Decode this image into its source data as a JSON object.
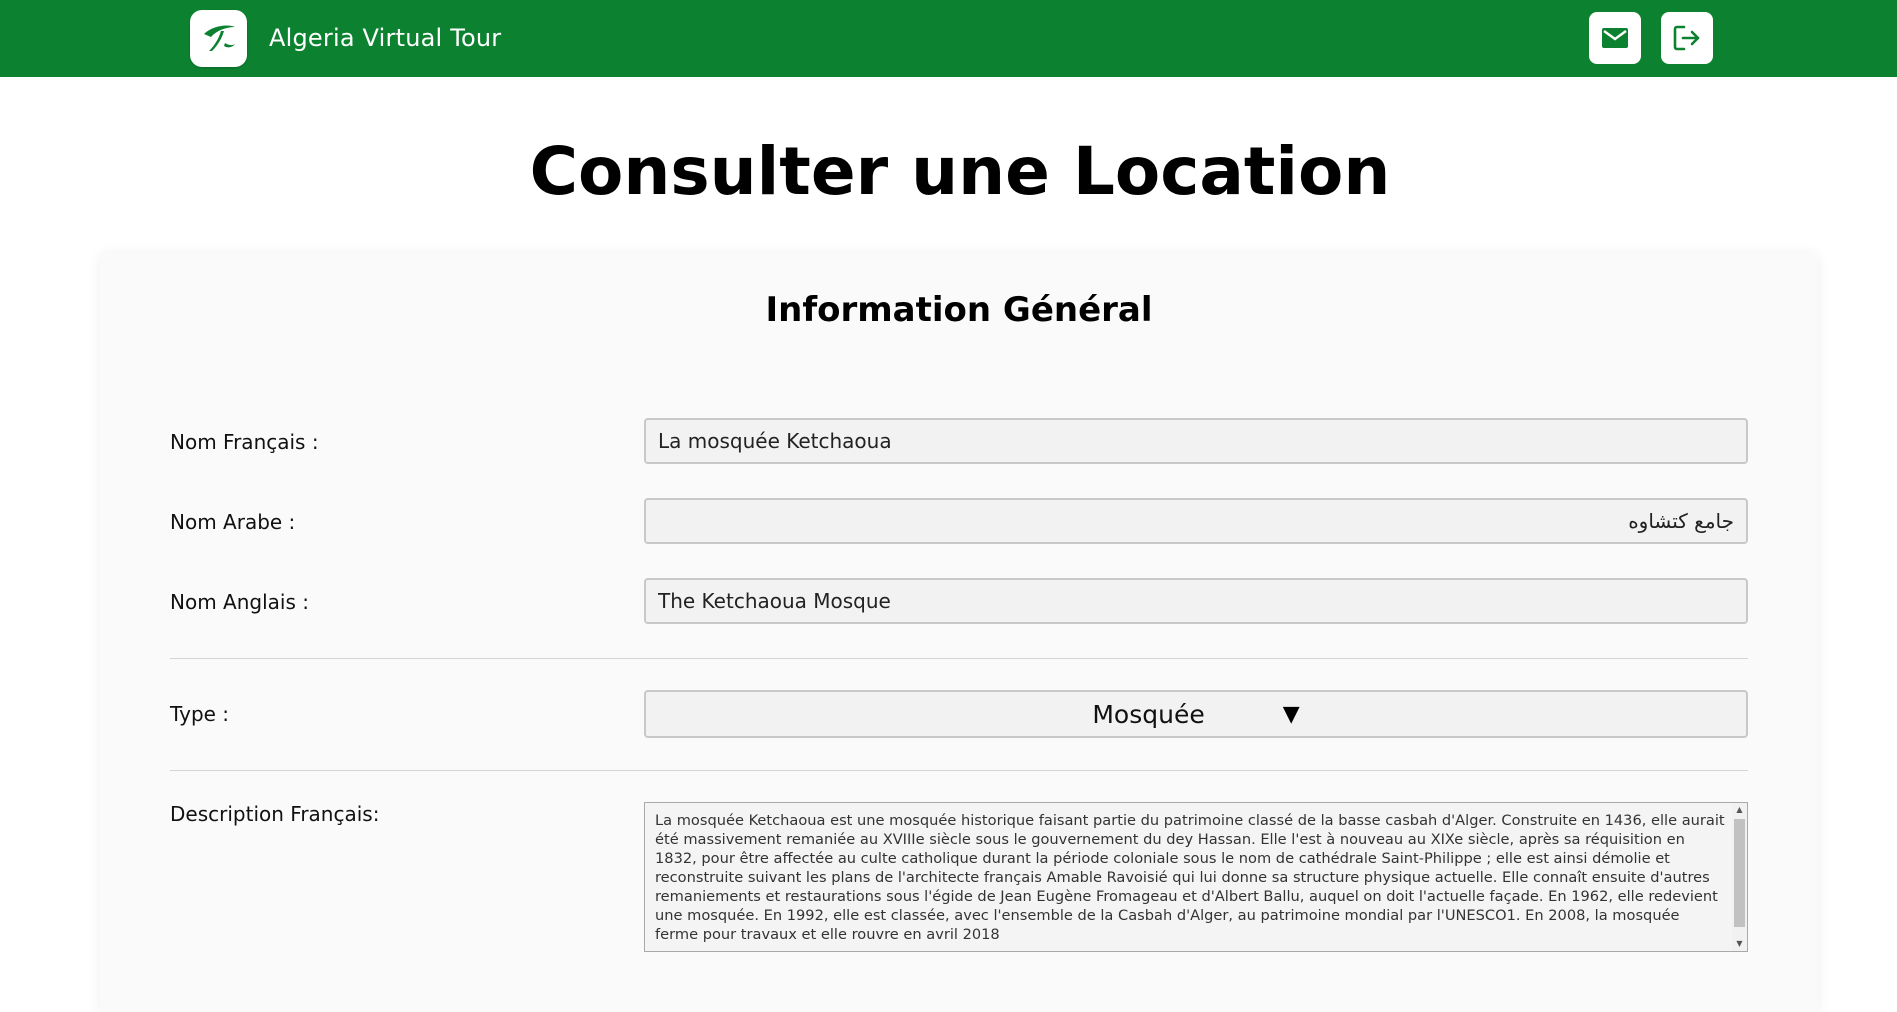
{
  "header": {
    "app_title": "Algeria Virtual Tour",
    "logo_icon": "swoosh-logo-icon",
    "mail_icon": "mail-icon",
    "logout_icon": "logout-icon",
    "brand_color": "#0c8230"
  },
  "page": {
    "title": "Consulter une Location"
  },
  "card": {
    "section_title": "Information Général",
    "fields": {
      "nom_francais": {
        "label": "Nom Français :",
        "value": "La mosquée Ketchaoua"
      },
      "nom_arabe": {
        "label": "Nom Arabe :",
        "value": "جامع كتشاوه"
      },
      "nom_anglais": {
        "label": "Nom Anglais :",
        "value": "The Ketchaoua Mosque"
      },
      "type": {
        "label": "Type :",
        "value": "Mosquée"
      },
      "description_fr": {
        "label": "Description Français:",
        "value": "La mosquée Ketchaoua est une mosquée historique faisant partie du patrimoine classé de la basse casbah d'Alger. Construite en 1436, elle aurait été massivement remaniée au XVIIIe siècle sous le gouvernement du dey Hassan. Elle l'est à nouveau au XIXe siècle, après sa réquisition en 1832, pour être affectée au culte catholique durant la période coloniale sous le nom de cathédrale Saint-Philippe ; elle est ainsi démolie et reconstruite suivant les plans de l'architecte français Amable Ravoisié qui lui donne sa structure physique actuelle. Elle connaît ensuite d'autres remaniements et restaurations sous l'égide de Jean Eugène Fromageau et d'Albert Ballu, auquel on doit l'actuelle façade. En 1962, elle redevient une mosquée. En 1992, elle est classée, avec l'ensemble de la Casbah d'Alger, au patrimoine mondial par l'UNESCO1. En 2008, la mosquée ferme pour travaux et elle rouvre en avril 2018"
      }
    }
  }
}
